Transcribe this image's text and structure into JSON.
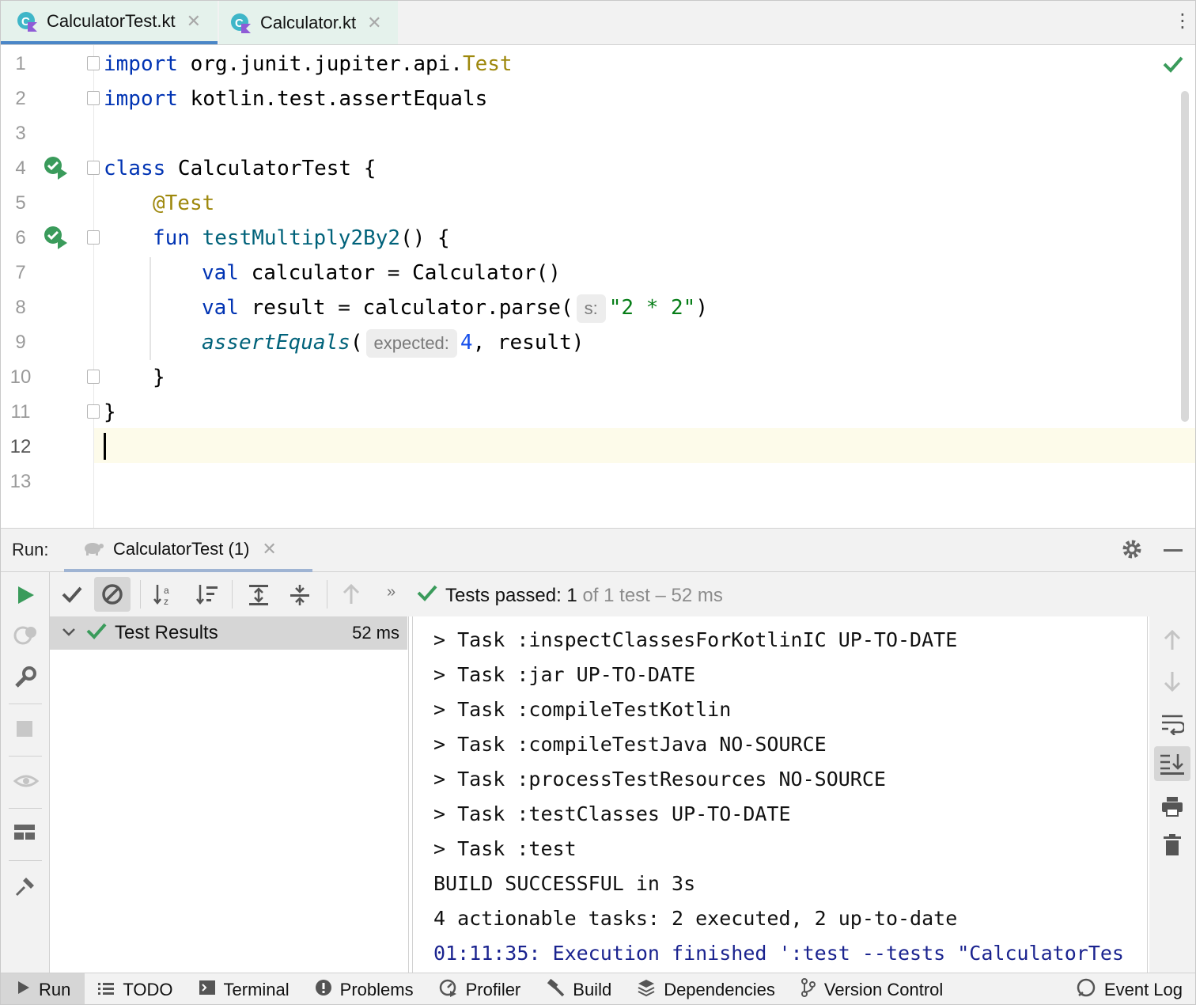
{
  "tabs": [
    {
      "label": "CalculatorTest.kt"
    },
    {
      "label": "Calculator.kt"
    }
  ],
  "editor": {
    "lines": [
      "1",
      "2",
      "3",
      "4",
      "5",
      "6",
      "7",
      "8",
      "9",
      "10",
      "11",
      "12",
      "13"
    ],
    "code": {
      "l1_kw": "import",
      "l1_rest": " org.junit.jupiter.api.",
      "l1_test": "Test",
      "l2_kw": "import",
      "l2_rest": " kotlin.test.assertEquals",
      "l4_kw": "class",
      "l4_rest": " CalculatorTest {",
      "l5_ann": "@Test",
      "l6_kw": "fun",
      "l6_fn": "testMultiply2By2",
      "l6_rest": "() {",
      "l7_kw": "val",
      "l7_rest": " calculator = Calculator()",
      "l8_kw": "val",
      "l8_rest": " result = calculator.parse(",
      "l8_hint": "s:",
      "l8_str": "\"2 * 2\"",
      "l8_end": ")",
      "l9_fn": "assertEquals",
      "l9_open": "(",
      "l9_hint": "expected:",
      "l9_num": "4",
      "l9_rest": ", result)",
      "l10": "}",
      "l11": "}"
    }
  },
  "run": {
    "label": "Run:",
    "tab": "CalculatorTest (1)",
    "status_prefix": "Tests passed:",
    "status_count": "1",
    "status_suffix": "of 1 test – 52 ms",
    "tree_root": "Test Results",
    "tree_time": "52 ms",
    "console": [
      "> Task :inspectClassesForKotlinIC UP-TO-DATE",
      "> Task :jar UP-TO-DATE",
      "> Task :compileTestKotlin",
      "> Task :compileTestJava NO-SOURCE",
      "> Task :processTestResources NO-SOURCE",
      "> Task :testClasses UP-TO-DATE",
      "> Task :test",
      "BUILD SUCCESSFUL in 3s",
      "4 actionable tasks: 2 executed, 2 up-to-date",
      "01:11:35: Execution finished ':test --tests \"CalculatorTes"
    ]
  },
  "bottombar": [
    "Run",
    "TODO",
    "Terminal",
    "Problems",
    "Profiler",
    "Build",
    "Dependencies",
    "Version Control",
    "Event Log"
  ]
}
